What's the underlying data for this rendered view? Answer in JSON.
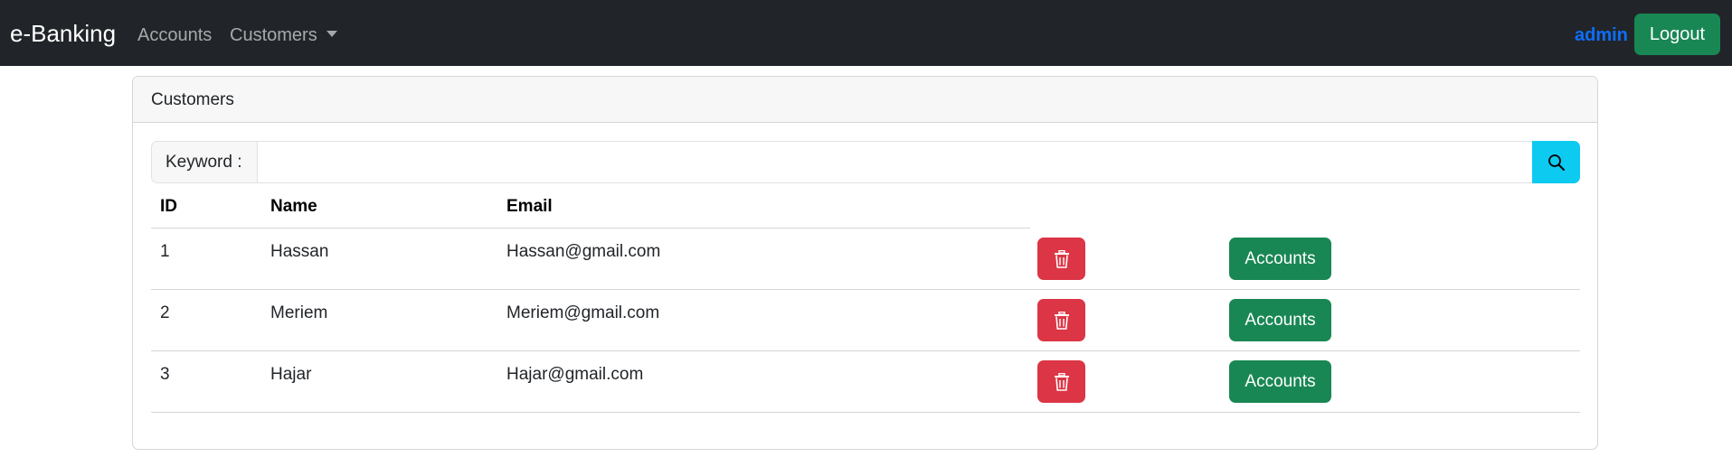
{
  "navbar": {
    "brand": "e-Banking",
    "links": {
      "accounts": "Accounts",
      "customers": "Customers"
    },
    "user": "admin",
    "logout": "Logout"
  },
  "card": {
    "title": "Customers"
  },
  "search": {
    "label": "Keyword :",
    "value": "",
    "placeholder": ""
  },
  "table": {
    "headers": {
      "id": "ID",
      "name": "Name",
      "email": "Email"
    },
    "rows": [
      {
        "id": "1",
        "name": "Hassan",
        "email": "Hassan@gmail.com",
        "action": "Accounts"
      },
      {
        "id": "2",
        "name": "Meriem",
        "email": "Meriem@gmail.com",
        "action": "Accounts"
      },
      {
        "id": "3",
        "name": "Hajar",
        "email": "Hajar@gmail.com",
        "action": "Accounts"
      }
    ]
  },
  "colors": {
    "navbar": "#212529",
    "success": "#198754",
    "danger": "#dc3545",
    "info": "#0dcaf0",
    "primary": "#0d6efd"
  },
  "icons": {
    "search": "search-icon",
    "delete": "trash-icon"
  }
}
